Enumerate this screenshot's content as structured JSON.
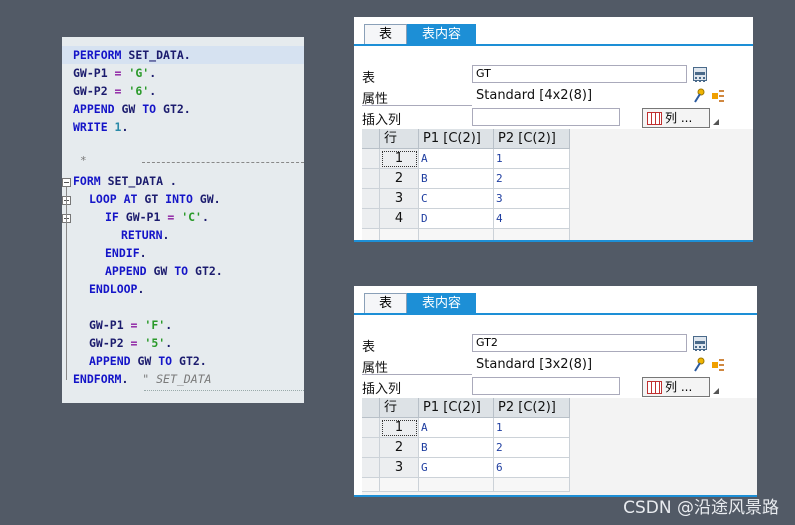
{
  "editor": {
    "lines": [
      {
        "parts": [
          {
            "c": "kw",
            "t": "PERFORM "
          },
          {
            "c": "tx",
            "t": "SET_DATA"
          },
          {
            "c": "tx",
            "t": "."
          }
        ]
      },
      {
        "parts": [
          {
            "c": "tx",
            "t": "GW-P1 "
          },
          {
            "c": "op",
            "t": "= "
          },
          {
            "c": "st",
            "t": "'G'"
          },
          {
            "c": "tx",
            "t": "."
          }
        ]
      },
      {
        "parts": [
          {
            "c": "tx",
            "t": "GW-P2 "
          },
          {
            "c": "op",
            "t": "= "
          },
          {
            "c": "st",
            "t": "'6'"
          },
          {
            "c": "tx",
            "t": "."
          }
        ]
      },
      {
        "parts": [
          {
            "c": "kw",
            "t": "APPEND "
          },
          {
            "c": "tx",
            "t": "GW "
          },
          {
            "c": "kw",
            "t": "TO "
          },
          {
            "c": "tx",
            "t": "GT2."
          }
        ]
      },
      {
        "parts": [
          {
            "c": "kw",
            "t": "WRITE "
          },
          {
            "c": "nm",
            "t": "1"
          },
          {
            "c": "tx",
            "t": "."
          }
        ]
      },
      {
        "parts": [
          {
            "c": "kw",
            "t": "FORM "
          },
          {
            "c": "tx",
            "t": "SET_DATA ."
          }
        ]
      },
      {
        "parts": [
          {
            "c": "kw",
            "t": "LOOP AT "
          },
          {
            "c": "tx",
            "t": "GT "
          },
          {
            "c": "kw",
            "t": "INTO "
          },
          {
            "c": "tx",
            "t": "GW."
          }
        ]
      },
      {
        "parts": [
          {
            "c": "kw",
            "t": "IF "
          },
          {
            "c": "tx",
            "t": "GW-P1 "
          },
          {
            "c": "op",
            "t": "= "
          },
          {
            "c": "st",
            "t": "'C'"
          },
          {
            "c": "tx",
            "t": "."
          }
        ]
      },
      {
        "parts": [
          {
            "c": "kw",
            "t": "RETURN"
          },
          {
            "c": "tx",
            "t": "."
          }
        ]
      },
      {
        "parts": [
          {
            "c": "kw",
            "t": "ENDIF"
          },
          {
            "c": "tx",
            "t": "."
          }
        ]
      },
      {
        "parts": [
          {
            "c": "kw",
            "t": "APPEND "
          },
          {
            "c": "tx",
            "t": "GW "
          },
          {
            "c": "kw",
            "t": "TO "
          },
          {
            "c": "tx",
            "t": "GT2."
          }
        ]
      },
      {
        "parts": [
          {
            "c": "kw",
            "t": "ENDLOOP"
          },
          {
            "c": "tx",
            "t": "."
          }
        ]
      },
      {
        "parts": [
          {
            "c": "tx",
            "t": "GW-P1 "
          },
          {
            "c": "op",
            "t": "= "
          },
          {
            "c": "st",
            "t": "'F'"
          },
          {
            "c": "tx",
            "t": "."
          }
        ]
      },
      {
        "parts": [
          {
            "c": "tx",
            "t": "GW-P2 "
          },
          {
            "c": "op",
            "t": "= "
          },
          {
            "c": "st",
            "t": "'5'"
          },
          {
            "c": "tx",
            "t": "."
          }
        ]
      },
      {
        "parts": [
          {
            "c": "kw",
            "t": "APPEND "
          },
          {
            "c": "tx",
            "t": "GW "
          },
          {
            "c": "kw",
            "t": "TO "
          },
          {
            "c": "tx",
            "t": "GT2."
          }
        ]
      },
      {
        "parts": [
          {
            "c": "kw",
            "t": "ENDFORM"
          },
          {
            "c": "tx",
            "t": ".  "
          },
          {
            "c": "cm",
            "t": "\" SET_DATA"
          }
        ]
      }
    ],
    "separator_star": "*"
  },
  "panels": [
    {
      "tabs": [
        "表",
        "表内容"
      ],
      "active_tab": 1,
      "fields": {
        "table_label": "表",
        "table_value": "GT",
        "attr_label": "属性",
        "attr_value": "Standard [4x2(8)]",
        "insert_label": "插入列",
        "insert_value": "",
        "col_button": "列 ..."
      },
      "headers": [
        "行",
        "P1 [C(2)]",
        "P2 [C(2)]"
      ],
      "rows": [
        [
          "1",
          "A",
          "1"
        ],
        [
          "2",
          "B",
          "2"
        ],
        [
          "3",
          "C",
          "3"
        ],
        [
          "4",
          "D",
          "4"
        ]
      ]
    },
    {
      "tabs": [
        "表",
        "表内容"
      ],
      "active_tab": 1,
      "fields": {
        "table_label": "表",
        "table_value": "GT2",
        "attr_label": "属性",
        "attr_value": "Standard [3x2(8)]",
        "insert_label": "插入列",
        "insert_value": "",
        "col_button": "列 ..."
      },
      "headers": [
        "行",
        "P1 [C(2)]",
        "P2 [C(2)]"
      ],
      "rows": [
        [
          "1",
          "A",
          "1"
        ],
        [
          "2",
          "B",
          "2"
        ],
        [
          "3",
          "G",
          "6"
        ]
      ]
    }
  ],
  "watermark": "CSDN @沿途风景路",
  "colors": {
    "accent": "#1d8fd6",
    "keyword": "#1414c8",
    "string": "#2a9a2a"
  }
}
